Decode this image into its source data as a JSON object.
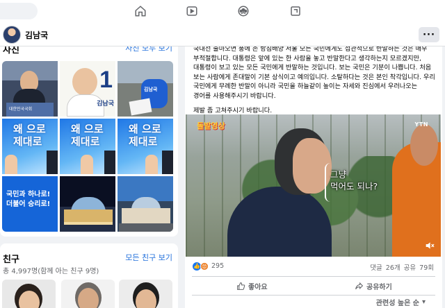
{
  "topnav": {
    "icons": [
      "home-icon",
      "watch-icon",
      "groups-icon",
      "gaming-icon"
    ]
  },
  "profile": {
    "name": "김남국",
    "more_label": "···"
  },
  "photos": {
    "title": "사진",
    "see_all": "사진 모두 보기",
    "press_podium_text": "대한민국국회",
    "poster_number": "1",
    "poster_name": "김남국",
    "vest_text": "김남국",
    "banner_text": "왜 으로\n제대로",
    "slogan_line1": "국민과 하나로!",
    "slogan_line2": "더불어 승리로!"
  },
  "friends": {
    "title": "친구",
    "see_all": "모든 친구 보기",
    "count_text": "총 4,997명(함께 아는 친구 9명)"
  },
  "post": {
    "paragraphs": [
      "국대선 출마오면 풍에 존 방침배양 서울 모든 국민에게도 섭관적으로 반말하는 것은 매우 부적절합니다. 대통령은 앞에 있는 한 사람을 놓고 반말한다고 생각하는지 모르겠지만, 대통령이 보고 있는 모든 국민에게 반말하는 것입니다. 보는 국민은 기분이 나쁩니다. 처음 보는 사람에게 존대말이 기본 상식이고 예의입니다. 소탈하다는 것은 본인 착각입니다. 우리 국민에게 무례한 반말이 아니라 국민을 하늘같이 높이는 자세와 진심에서 우러나오는 경어를 사용해주시기 바랍니다.",
      "제발 좀 고쳐주시기 바랍니다."
    ],
    "video": {
      "logo": "돌발영상",
      "broadcaster": "YTN",
      "caption": "그냥\n먹어도 되나?"
    },
    "reaction_count": "295",
    "comments_shares": "댓글 26개  공유 79회",
    "like_label": "좋아요",
    "share_label": "공유하기",
    "sort_label": "관련성 높은 순"
  }
}
